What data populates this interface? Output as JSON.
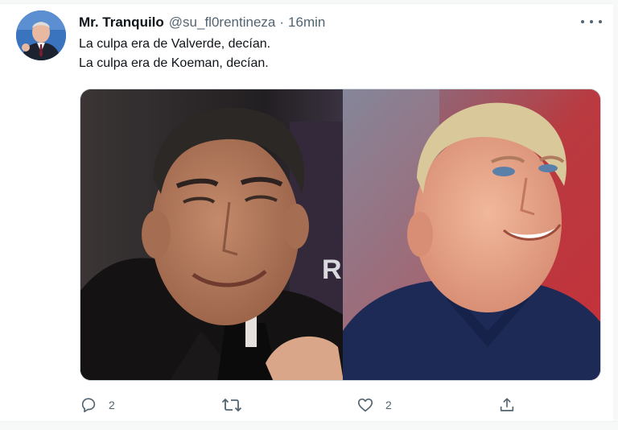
{
  "tweet": {
    "author_name": "Mr. Tranquilo",
    "handle": "@su_fl0rentineza",
    "separator": "·",
    "time": "16min",
    "lines": [
      "La culpa era de Valverde, decían.",
      "La culpa era de Koeman, decían."
    ]
  },
  "media": {
    "left_image": "smiling man in black coat, dark stadium background",
    "right_image": "smiling blond man in navy polo shirt, red blurred background",
    "left_overlay_text": "R"
  },
  "actions": {
    "reply_count": "2",
    "retweet_count": "",
    "like_count": "2"
  },
  "icons": {
    "reply": "reply-icon",
    "retweet": "retweet-icon",
    "like": "heart-icon",
    "share": "share-icon",
    "more": "more-options-icon"
  },
  "colors": {
    "text": "#0f1419",
    "muted": "#536471",
    "avatar_bg": "#3a74bf"
  }
}
